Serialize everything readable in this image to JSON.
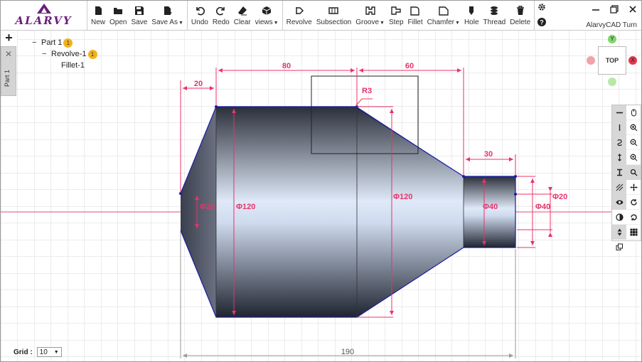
{
  "logo": {
    "text": "ALARVY"
  },
  "toolbar": {
    "file": [
      {
        "label": "New",
        "icon": "new-file-icon"
      },
      {
        "label": "Open",
        "icon": "open-folder-icon"
      },
      {
        "label": "Save",
        "icon": "save-icon"
      },
      {
        "label": "Save As",
        "icon": "save-as-icon",
        "dropdown": true
      }
    ],
    "edit": [
      {
        "label": "Undo",
        "icon": "undo-icon"
      },
      {
        "label": "Redo",
        "icon": "redo-icon"
      },
      {
        "label": "Clear",
        "icon": "eraser-icon"
      },
      {
        "label": "views",
        "icon": "cube-icon",
        "dropdown": true
      }
    ],
    "features": [
      {
        "label": "Revolve",
        "icon": "revolve-icon"
      },
      {
        "label": "Subsection",
        "icon": "subsection-icon"
      },
      {
        "label": "Groove",
        "icon": "groove-icon",
        "dropdown": true
      },
      {
        "label": "Step",
        "icon": "step-icon"
      },
      {
        "label": "Fillet",
        "icon": "fillet-icon"
      },
      {
        "label": "Chamfer",
        "icon": "chamfer-icon",
        "dropdown": true
      },
      {
        "label": "Hole",
        "icon": "hole-icon"
      },
      {
        "label": "Thread",
        "icon": "thread-icon"
      },
      {
        "label": "Delete",
        "icon": "trash-icon"
      }
    ]
  },
  "app_title": "AlarvyCAD Turn",
  "left_panel": {
    "add_label": "+",
    "close_label": "✕",
    "tab_label": "Part 1"
  },
  "tree": [
    {
      "toggle": "−",
      "label": "Part 1",
      "badge": "1"
    },
    {
      "toggle": "−",
      "label": "Revolve-1",
      "badge": "1"
    },
    {
      "toggle": "",
      "label": "Fillet-1",
      "badge": ""
    }
  ],
  "viewcube": {
    "face": "TOP",
    "y": "Y",
    "x": "X"
  },
  "dimensions": {
    "top_left": "20",
    "top_mid": "80",
    "top_right": "60",
    "step_len": "30",
    "fillet": "R3",
    "dia_tip": "Φ20",
    "dia_main": "Φ120",
    "dia_cone": "Φ120",
    "dia_neck": "Φ40",
    "dia_neck_out": "Φ40",
    "dia_end": "Φ20",
    "overall": "190"
  },
  "colors": {
    "dimension": "#e8336a",
    "grid": "#d9d9d9",
    "outline": "#1a1aa8",
    "axis": "#e05070"
  },
  "grid": {
    "label": "Grid :",
    "value": "10"
  }
}
